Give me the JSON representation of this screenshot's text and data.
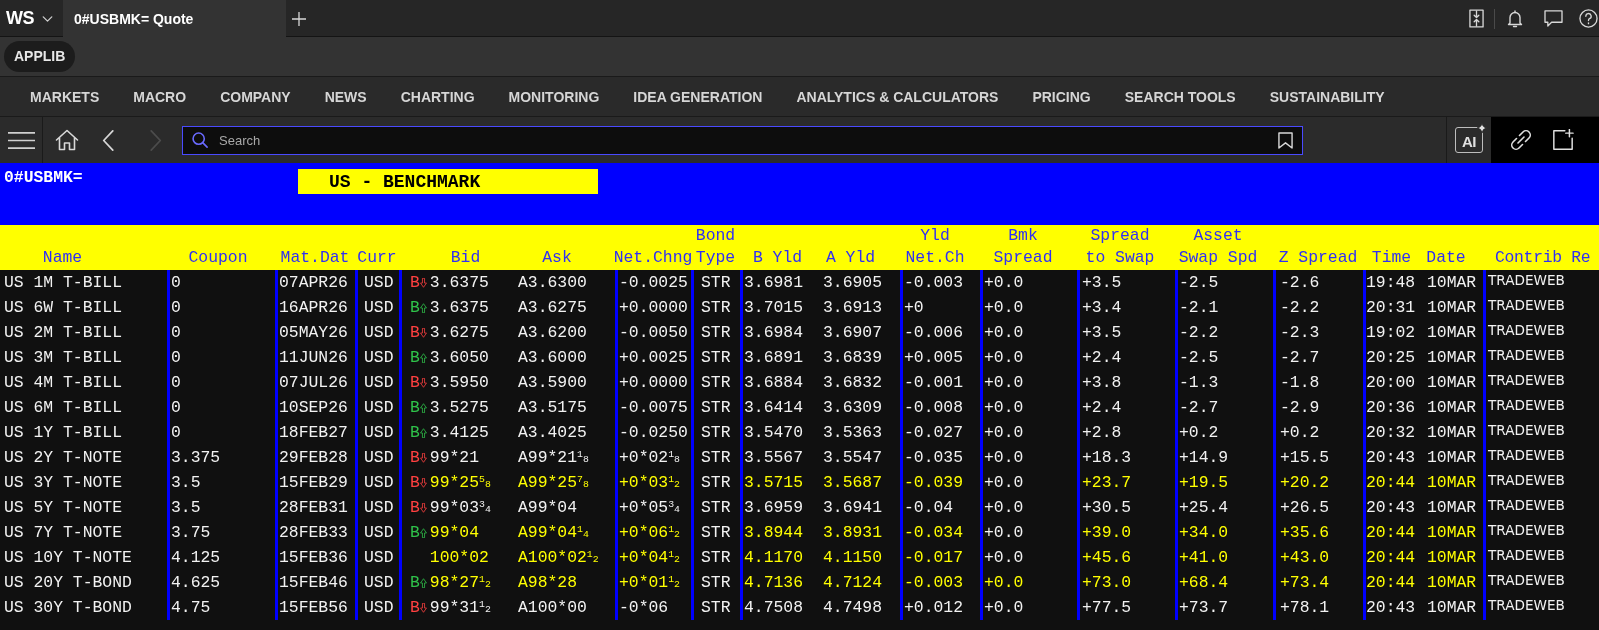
{
  "title_bar": {
    "logo": "WS",
    "tabs": [
      {
        "label": "0#USBMK= Quote",
        "selected": true
      }
    ]
  },
  "app_bar": {
    "button": "APPLIB"
  },
  "menu": [
    "MARKETS",
    "MACRO",
    "COMPANY",
    "NEWS",
    "CHARTING",
    "MONITORING",
    "IDEA GENERATION",
    "ANALYTICS & CALCULATORS",
    "PRICING",
    "SEARCH TOOLS",
    "SUSTAINABILITY"
  ],
  "toolbar": {
    "nav_buttons": [
      {
        "kind": "back",
        "disabled": false
      },
      {
        "kind": "forward",
        "disabled": true
      }
    ],
    "search": {
      "placeholder": "Search"
    },
    "ai_button": "AI"
  },
  "page": {
    "code": "0#USBMK=",
    "title": "US - BENCHMARK"
  },
  "table": {
    "columns": [
      {
        "label": "Name"
      },
      {
        "label": "Coupon"
      },
      {
        "label": "Mat.Dat"
      },
      {
        "label": "Curr"
      },
      {
        "label": "Bid"
      },
      {
        "label": "Ask"
      },
      {
        "label": "Net.Chng"
      },
      {
        "top": "Bond",
        "label": "Type"
      },
      {
        "label": "B Yld"
      },
      {
        "label": "A Yld"
      },
      {
        "top": "Yld",
        "label": "Net.Ch"
      },
      {
        "top": "Bmk",
        "label": "Spread"
      },
      {
        "top": "Spread",
        "label": "to Swap"
      },
      {
        "top": "Asset",
        "label": "Swap Spd"
      },
      {
        "label": "Z Spread"
      },
      {
        "label": "Time"
      },
      {
        "label": "Date"
      },
      {
        "label": "Contrib Re"
      }
    ],
    "rows": [
      {
        "name": "US 1M T-BILL",
        "coupon": "0",
        "maturity": "07APR26",
        "currency": "USD",
        "bid": {
          "marker": "B",
          "kind": "down",
          "text": "3.6375",
          "updated": false
        },
        "ask": {
          "text": "A3.6300",
          "updated": false
        },
        "net_change": {
          "text": "-0.0025",
          "updated": false
        },
        "bond_type": "STR",
        "b_yield": {
          "text": "3.6981",
          "updated": false
        },
        "a_yield": {
          "text": "3.6905",
          "updated": false
        },
        "yield_net_change": {
          "text": "-0.003",
          "updated": false
        },
        "benchmark_spread": {
          "text": "+0.0",
          "updated": false
        },
        "spread_to_swap": {
          "text": "+3.5",
          "updated": false
        },
        "asset_swap_spread": {
          "text": "-2.5",
          "updated": false
        },
        "z_spread": {
          "text": "-2.6",
          "updated": false
        },
        "time": {
          "text": "19:48",
          "updated": false
        },
        "date": {
          "text": "10MAR",
          "updated": false
        },
        "contributor": "TRADEWEB"
      },
      {
        "name": "US 6W T-BILL",
        "coupon": "0",
        "maturity": "16APR26",
        "currency": "USD",
        "bid": {
          "marker": "B",
          "kind": "up",
          "text": "3.6375",
          "updated": false
        },
        "ask": {
          "text": "A3.6275",
          "updated": false
        },
        "net_change": {
          "text": "+0.0000",
          "updated": false
        },
        "bond_type": "STR",
        "b_yield": {
          "text": "3.7015",
          "updated": false
        },
        "a_yield": {
          "text": "3.6913",
          "updated": false
        },
        "yield_net_change": {
          "text": "+0",
          "updated": false
        },
        "benchmark_spread": {
          "text": "+0.0",
          "updated": false
        },
        "spread_to_swap": {
          "text": "+3.4",
          "updated": false
        },
        "asset_swap_spread": {
          "text": "-2.1",
          "updated": false
        },
        "z_spread": {
          "text": "-2.2",
          "updated": false
        },
        "time": {
          "text": "20:31",
          "updated": false
        },
        "date": {
          "text": "10MAR",
          "updated": false
        },
        "contributor": "TRADEWEB"
      },
      {
        "name": "US 2M T-BILL",
        "coupon": "0",
        "maturity": "05MAY26",
        "currency": "USD",
        "bid": {
          "marker": "B",
          "kind": "down",
          "text": "3.6275",
          "updated": false
        },
        "ask": {
          "text": "A3.6200",
          "updated": false
        },
        "net_change": {
          "text": "-0.0050",
          "updated": false
        },
        "bond_type": "STR",
        "b_yield": {
          "text": "3.6984",
          "updated": false
        },
        "a_yield": {
          "text": "3.6907",
          "updated": false
        },
        "yield_net_change": {
          "text": "-0.006",
          "updated": false
        },
        "benchmark_spread": {
          "text": "+0.0",
          "updated": false
        },
        "spread_to_swap": {
          "text": "+3.5",
          "updated": false
        },
        "asset_swap_spread": {
          "text": "-2.2",
          "updated": false
        },
        "z_spread": {
          "text": "-2.3",
          "updated": false
        },
        "time": {
          "text": "19:02",
          "updated": false
        },
        "date": {
          "text": "10MAR",
          "updated": false
        },
        "contributor": "TRADEWEB"
      },
      {
        "name": "US 3M T-BILL",
        "coupon": "0",
        "maturity": "11JUN26",
        "currency": "USD",
        "bid": {
          "marker": "B",
          "kind": "up",
          "text": "3.6050",
          "updated": false
        },
        "ask": {
          "text": "A3.6000",
          "updated": false
        },
        "net_change": {
          "text": "+0.0025",
          "updated": false
        },
        "bond_type": "STR",
        "b_yield": {
          "text": "3.6891",
          "updated": false
        },
        "a_yield": {
          "text": "3.6839",
          "updated": false
        },
        "yield_net_change": {
          "text": "+0.005",
          "updated": false
        },
        "benchmark_spread": {
          "text": "+0.0",
          "updated": false
        },
        "spread_to_swap": {
          "text": "+2.4",
          "updated": false
        },
        "asset_swap_spread": {
          "text": "-2.5",
          "updated": false
        },
        "z_spread": {
          "text": "-2.7",
          "updated": false
        },
        "time": {
          "text": "20:25",
          "updated": false
        },
        "date": {
          "text": "10MAR",
          "updated": false
        },
        "contributor": "TRADEWEB"
      },
      {
        "name": "US 4M T-BILL",
        "coupon": "0",
        "maturity": "07JUL26",
        "currency": "USD",
        "bid": {
          "marker": "B",
          "kind": "down",
          "text": "3.5950",
          "updated": false
        },
        "ask": {
          "text": "A3.5900",
          "updated": false
        },
        "net_change": {
          "text": "+0.0000",
          "updated": false
        },
        "bond_type": "STR",
        "b_yield": {
          "text": "3.6884",
          "updated": false
        },
        "a_yield": {
          "text": "3.6832",
          "updated": false
        },
        "yield_net_change": {
          "text": "-0.001",
          "updated": false
        },
        "benchmark_spread": {
          "text": "+0.0",
          "updated": false
        },
        "spread_to_swap": {
          "text": "+3.8",
          "updated": false
        },
        "asset_swap_spread": {
          "text": "-1.3",
          "updated": false
        },
        "z_spread": {
          "text": "-1.8",
          "updated": false
        },
        "time": {
          "text": "20:00",
          "updated": false
        },
        "date": {
          "text": "10MAR",
          "updated": false
        },
        "contributor": "TRADEWEB"
      },
      {
        "name": "US 6M T-BILL",
        "coupon": "0",
        "maturity": "10SEP26",
        "currency": "USD",
        "bid": {
          "marker": "B",
          "kind": "up",
          "text": "3.5275",
          "updated": false
        },
        "ask": {
          "text": "A3.5175",
          "updated": false
        },
        "net_change": {
          "text": "-0.0075",
          "updated": false
        },
        "bond_type": "STR",
        "b_yield": {
          "text": "3.6414",
          "updated": false
        },
        "a_yield": {
          "text": "3.6309",
          "updated": false
        },
        "yield_net_change": {
          "text": "-0.008",
          "updated": false
        },
        "benchmark_spread": {
          "text": "+0.0",
          "updated": false
        },
        "spread_to_swap": {
          "text": "+2.4",
          "updated": false
        },
        "asset_swap_spread": {
          "text": "-2.7",
          "updated": false
        },
        "z_spread": {
          "text": "-2.9",
          "updated": false
        },
        "time": {
          "text": "20:36",
          "updated": false
        },
        "date": {
          "text": "10MAR",
          "updated": false
        },
        "contributor": "TRADEWEB"
      },
      {
        "name": "US 1Y T-BILL",
        "coupon": "0",
        "maturity": "18FEB27",
        "currency": "USD",
        "bid": {
          "marker": "B",
          "kind": "up",
          "text": "3.4125",
          "updated": false
        },
        "ask": {
          "text": "A3.4025",
          "updated": false
        },
        "net_change": {
          "text": "-0.0250",
          "updated": false
        },
        "bond_type": "STR",
        "b_yield": {
          "text": "3.5470",
          "updated": false
        },
        "a_yield": {
          "text": "3.5363",
          "updated": false
        },
        "yield_net_change": {
          "text": "-0.027",
          "updated": false
        },
        "benchmark_spread": {
          "text": "+0.0",
          "updated": false
        },
        "spread_to_swap": {
          "text": "+2.8",
          "updated": false
        },
        "asset_swap_spread": {
          "text": "+0.2",
          "updated": false
        },
        "z_spread": {
          "text": "+0.2",
          "updated": false
        },
        "time": {
          "text": "20:32",
          "updated": false
        },
        "date": {
          "text": "10MAR",
          "updated": false
        },
        "contributor": "TRADEWEB"
      },
      {
        "name": "US 2Y T-NOTE",
        "coupon": "3.375",
        "maturity": "29FEB28",
        "currency": "USD",
        "bid": {
          "marker": "B",
          "kind": "down",
          "text": "99*21",
          "updated": false
        },
        "ask": {
          "text": "A99*21$^{1}$$_{8}$",
          "updated": false
        },
        "net_change": {
          "text": "+0*02$^{1}$$_{8}$",
          "updated": false
        },
        "bond_type": "STR",
        "b_yield": {
          "text": "3.5567",
          "updated": false
        },
        "a_yield": {
          "text": "3.5547",
          "updated": false
        },
        "yield_net_change": {
          "text": "-0.035",
          "updated": false
        },
        "benchmark_spread": {
          "text": "+0.0",
          "updated": false
        },
        "spread_to_swap": {
          "text": "+18.3",
          "updated": false
        },
        "asset_swap_spread": {
          "text": "+14.9",
          "updated": false
        },
        "z_spread": {
          "text": "+15.5",
          "updated": false
        },
        "time": {
          "text": "20:43",
          "updated": false
        },
        "date": {
          "text": "10MAR",
          "updated": false
        },
        "contributor": "TRADEWEB"
      },
      {
        "name": "US 3Y T-NOTE",
        "coupon": "3.5",
        "maturity": "15FEB29",
        "currency": "USD",
        "bid": {
          "marker": "B",
          "kind": "down",
          "text": "99*25$^{5}$$_{8}$",
          "updated": true
        },
        "ask": {
          "text": "A99*25$^{7}$$_{8}$",
          "updated": true
        },
        "net_change": {
          "text": "+0*03$^{1}$$_{2}$",
          "updated": true
        },
        "bond_type": "STR",
        "b_yield": {
          "text": "3.5715",
          "updated": true
        },
        "a_yield": {
          "text": "3.5687",
          "updated": true
        },
        "yield_net_change": {
          "text": "-0.039",
          "updated": true
        },
        "benchmark_spread": {
          "text": "+0.0",
          "updated": false
        },
        "spread_to_swap": {
          "text": "+23.7",
          "updated": true
        },
        "asset_swap_spread": {
          "text": "+19.5",
          "updated": true
        },
        "z_spread": {
          "text": "+20.2",
          "updated": true
        },
        "time": {
          "text": "20:44",
          "updated": true
        },
        "date": {
          "text": "10MAR",
          "updated": true
        },
        "contributor": "TRADEWEB"
      },
      {
        "name": "US 5Y T-NOTE",
        "coupon": "3.5",
        "maturity": "28FEB31",
        "currency": "USD",
        "bid": {
          "marker": "B",
          "kind": "down",
          "text": "99*03$^{3}$$_{4}$",
          "updated": false
        },
        "ask": {
          "text": "A99*04",
          "updated": false
        },
        "net_change": {
          "text": "+0*05$^{3}$$_{4}$",
          "updated": false
        },
        "bond_type": "STR",
        "b_yield": {
          "text": "3.6959",
          "updated": false
        },
        "a_yield": {
          "text": "3.6941",
          "updated": false
        },
        "yield_net_change": {
          "text": "-0.04",
          "updated": false
        },
        "benchmark_spread": {
          "text": "+0.0",
          "updated": false
        },
        "spread_to_swap": {
          "text": "+30.5",
          "updated": false
        },
        "asset_swap_spread": {
          "text": "+25.4",
          "updated": false
        },
        "z_spread": {
          "text": "+26.5",
          "updated": false
        },
        "time": {
          "text": "20:43",
          "updated": false
        },
        "date": {
          "text": "10MAR",
          "updated": false
        },
        "contributor": "TRADEWEB"
      },
      {
        "name": "US 7Y T-NOTE",
        "coupon": "3.75",
        "maturity": "28FEB33",
        "currency": "USD",
        "bid": {
          "marker": "B",
          "kind": "up",
          "text": "99*04",
          "updated": true
        },
        "ask": {
          "text": "A99*04$^{1}$$_{4}$",
          "updated": true
        },
        "net_change": {
          "text": "+0*06$^{1}$$_{2}$",
          "updated": true
        },
        "bond_type": "STR",
        "b_yield": {
          "text": "3.8944",
          "updated": true
        },
        "a_yield": {
          "text": "3.8931",
          "updated": true
        },
        "yield_net_change": {
          "text": "-0.034",
          "updated": true
        },
        "benchmark_spread": {
          "text": "+0.0",
          "updated": false
        },
        "spread_to_swap": {
          "text": "+39.0",
          "updated": true
        },
        "asset_swap_spread": {
          "text": "+34.0",
          "updated": true
        },
        "z_spread": {
          "text": "+35.6",
          "updated": true
        },
        "time": {
          "text": "20:44",
          "updated": true
        },
        "date": {
          "text": "10MAR",
          "updated": true
        },
        "contributor": "TRADEWEB"
      },
      {
        "name": "US 10Y T-NOTE",
        "coupon": "4.125",
        "maturity": "15FEB36",
        "currency": "USD",
        "bid": {
          "kind": "plain",
          "text": "100*02",
          "updated": true
        },
        "ask": {
          "text": "A100*02$^{1}$$_{2}$",
          "updated": true
        },
        "net_change": {
          "text": "+0*04$^{1}$$_{2}$",
          "updated": true
        },
        "bond_type": "STR",
        "b_yield": {
          "text": "4.1170",
          "updated": true
        },
        "a_yield": {
          "text": "4.1150",
          "updated": true
        },
        "yield_net_change": {
          "text": "-0.017",
          "updated": true
        },
        "benchmark_spread": {
          "text": "+0.0",
          "updated": false
        },
        "spread_to_swap": {
          "text": "+45.6",
          "updated": true
        },
        "asset_swap_spread": {
          "text": "+41.0",
          "updated": true
        },
        "z_spread": {
          "text": "+43.0",
          "updated": true
        },
        "time": {
          "text": "20:44",
          "updated": true
        },
        "date": {
          "text": "10MAR",
          "updated": true
        },
        "contributor": "TRADEWEB"
      },
      {
        "name": "US 20Y T-BOND",
        "coupon": "4.625",
        "maturity": "15FEB46",
        "currency": "USD",
        "bid": {
          "marker": "B",
          "kind": "up",
          "text": "98*27$^{1}$$_{2}$",
          "updated": true
        },
        "ask": {
          "text": "A98*28",
          "updated": true
        },
        "net_change": {
          "text": "+0*01$^{1}$$_{2}$",
          "updated": true
        },
        "bond_type": "STR",
        "b_yield": {
          "text": "4.7136",
          "updated": true
        },
        "a_yield": {
          "text": "4.7124",
          "updated": true
        },
        "yield_net_change": {
          "text": "-0.003",
          "updated": true
        },
        "benchmark_spread": {
          "text": "+0.0",
          "updated": true
        },
        "spread_to_swap": {
          "text": "+73.0",
          "updated": true
        },
        "asset_swap_spread": {
          "text": "+68.4",
          "updated": true
        },
        "z_spread": {
          "text": "+73.4",
          "updated": true
        },
        "time": {
          "text": "20:44",
          "updated": true
        },
        "date": {
          "text": "10MAR",
          "updated": true
        },
        "contributor": "TRADEWEB"
      },
      {
        "name": "US 30Y T-BOND",
        "coupon": "4.75",
        "maturity": "15FEB56",
        "currency": "USD",
        "bid": {
          "marker": "B",
          "kind": "down",
          "text": "99*31$^{1}$$_{2}$",
          "updated": false
        },
        "ask": {
          "text": "A100*00",
          "updated": false
        },
        "net_change": {
          "text": "-0*06",
          "updated": false
        },
        "bond_type": "STR",
        "b_yield": {
          "text": "4.7508",
          "updated": false
        },
        "a_yield": {
          "text": "4.7498",
          "updated": false
        },
        "yield_net_change": {
          "text": "+0.012",
          "updated": false
        },
        "benchmark_spread": {
          "text": "+0.0",
          "updated": false
        },
        "spread_to_swap": {
          "text": "+77.5",
          "updated": false
        },
        "asset_swap_spread": {
          "text": "+73.7",
          "updated": false
        },
        "z_spread": {
          "text": "+78.1",
          "updated": false
        },
        "time": {
          "text": "20:43",
          "updated": false
        },
        "date": {
          "text": "10MAR",
          "updated": false
        },
        "contributor": "TRADEWEB"
      }
    ]
  }
}
